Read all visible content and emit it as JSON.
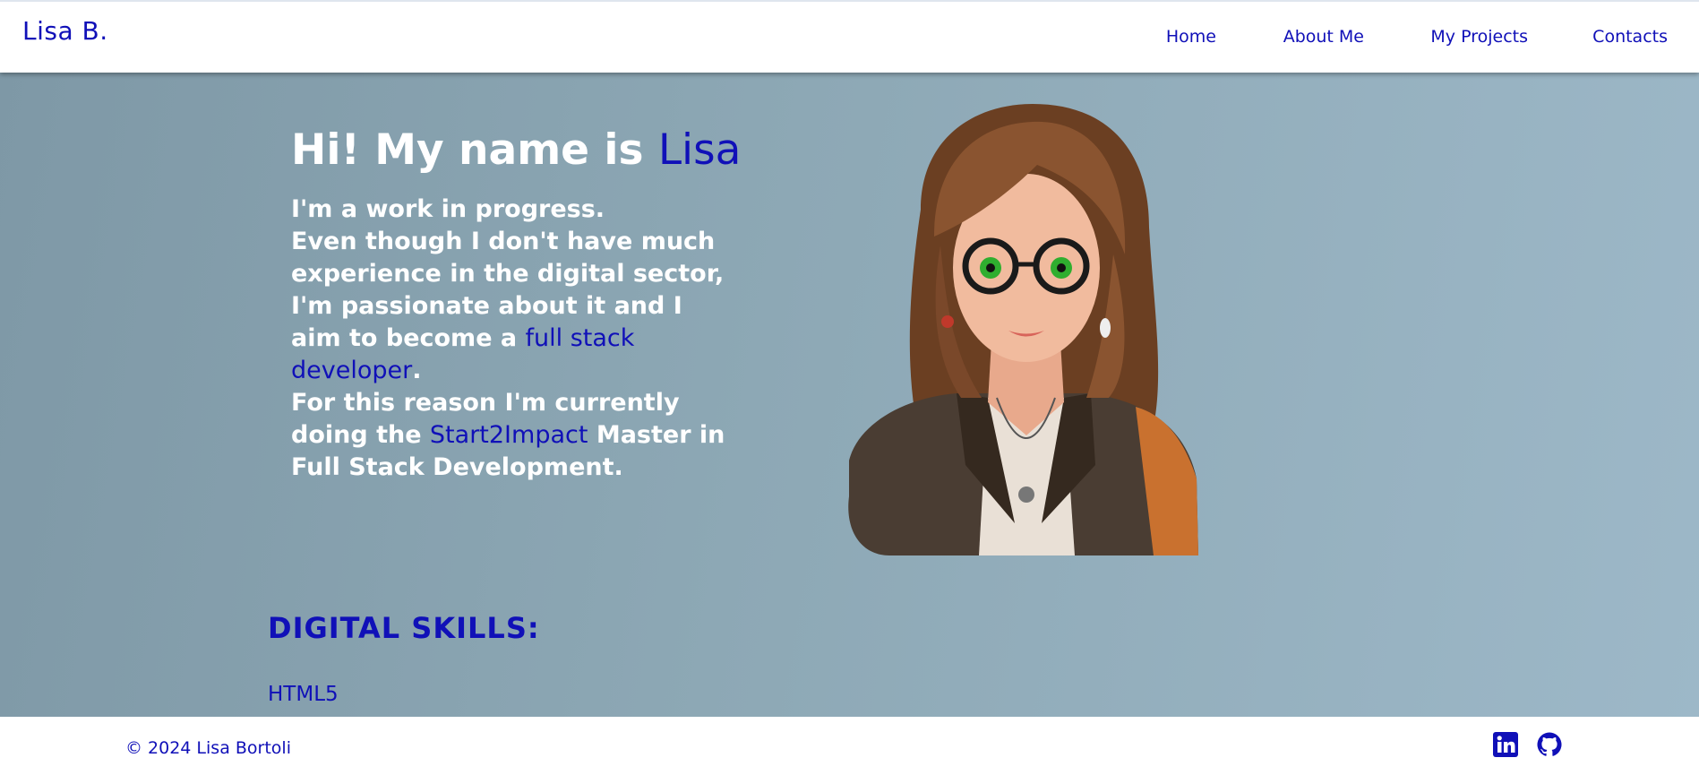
{
  "header": {
    "brand": "Lisa B.",
    "nav": [
      {
        "label": "Home"
      },
      {
        "label": "About Me"
      },
      {
        "label": "My Projects"
      },
      {
        "label": "Contacts"
      }
    ]
  },
  "hero": {
    "title_prefix": "Hi! My name is ",
    "title_name": "Lisa",
    "line1": "I'm a work in progress.",
    "para2_a": "Even though I don't have much experience in the digital sector, I'm passionate about it and I aim to become a ",
    "para2_link": "full stack developer",
    "para2_b": ".",
    "para3_a": "For this reason I'm currently doing the ",
    "para3_link": "Start2Impact",
    "para3_b": " Master in Full Stack Development."
  },
  "avatar": {
    "icon": "cartoon-portrait"
  },
  "skills": {
    "title": "DIGITAL SKILLS:",
    "items": [
      "HTML5"
    ]
  },
  "footer": {
    "copyright": "© 2024 Lisa Bortoli",
    "icons": [
      "linkedin-icon",
      "github-icon"
    ]
  },
  "colors": {
    "accent": "#1010b8",
    "text_light": "#ffffff",
    "bar_bg": "#ffffff"
  }
}
